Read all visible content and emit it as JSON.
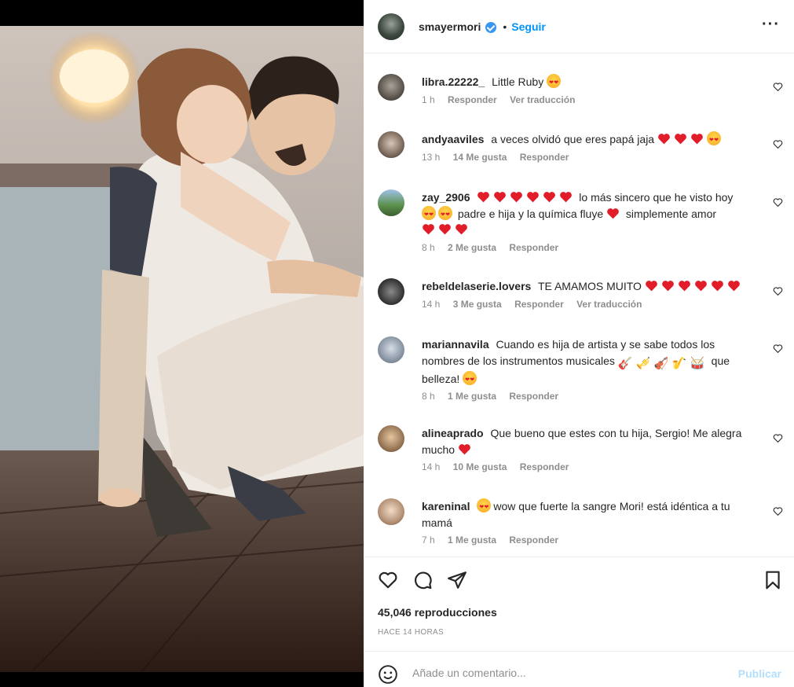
{
  "post": {
    "username": "smayermori",
    "follow_label": "Seguir",
    "more_icon": "more-options-icon",
    "views": "45,046 reproducciones",
    "time": "HACE 14 HORAS"
  },
  "comments": [
    {
      "user": "libra.22222_",
      "text": "Little Ruby",
      "time": "1 h",
      "likes": "",
      "reply": "Responder",
      "translate": "Ver traducción"
    },
    {
      "user": "andyaaviles",
      "text": "a veces olvidó que eres papá jaja",
      "time": "13 h",
      "likes": "14 Me gusta",
      "reply": "Responder",
      "translate": ""
    },
    {
      "user": "zay_2906",
      "text_a": "lo más sincero que he visto hoy",
      "text_b": "padre e hija y la química fluye",
      "text_c": "simplemente amor",
      "time": "8 h",
      "likes": "2 Me gusta",
      "reply": "Responder",
      "translate": ""
    },
    {
      "user": "rebeldelaserie.lovers",
      "text": "TE AMAMOS MUITO",
      "time": "14 h",
      "likes": "3 Me gusta",
      "reply": "Responder",
      "translate": "Ver traducción"
    },
    {
      "user": "mariannavila",
      "text_a": "Cuando es hija de artista y se sabe todos los nombres de los instrumentos musicales",
      "text_b": "que belleza!",
      "time": "8 h",
      "likes": "1 Me gusta",
      "reply": "Responder",
      "translate": ""
    },
    {
      "user": "alineaprado",
      "text_a": "Que bueno que estes con tu hija, Sergio! Me alegra mucho",
      "time": "14 h",
      "likes": "10 Me gusta",
      "reply": "Responder",
      "translate": ""
    },
    {
      "user": "kareninal",
      "text": "wow que fuerte la sangre Mori! está idéntica a tu mamá",
      "time": "7 h",
      "likes": "1 Me gusta",
      "reply": "Responder",
      "translate": ""
    }
  ],
  "add_comment": {
    "placeholder": "Añade un comentario...",
    "publish_label": "Publicar"
  },
  "colors": {
    "accent": "#0095f6",
    "publish_disabled": "#b2dffc",
    "heart_emoji": "#e11d2a",
    "muted": "#8e8e8e"
  },
  "icons": [
    "heart-icon",
    "comment-icon",
    "share-icon",
    "bookmark-icon",
    "emoji-icon",
    "verified-badge-icon"
  ]
}
